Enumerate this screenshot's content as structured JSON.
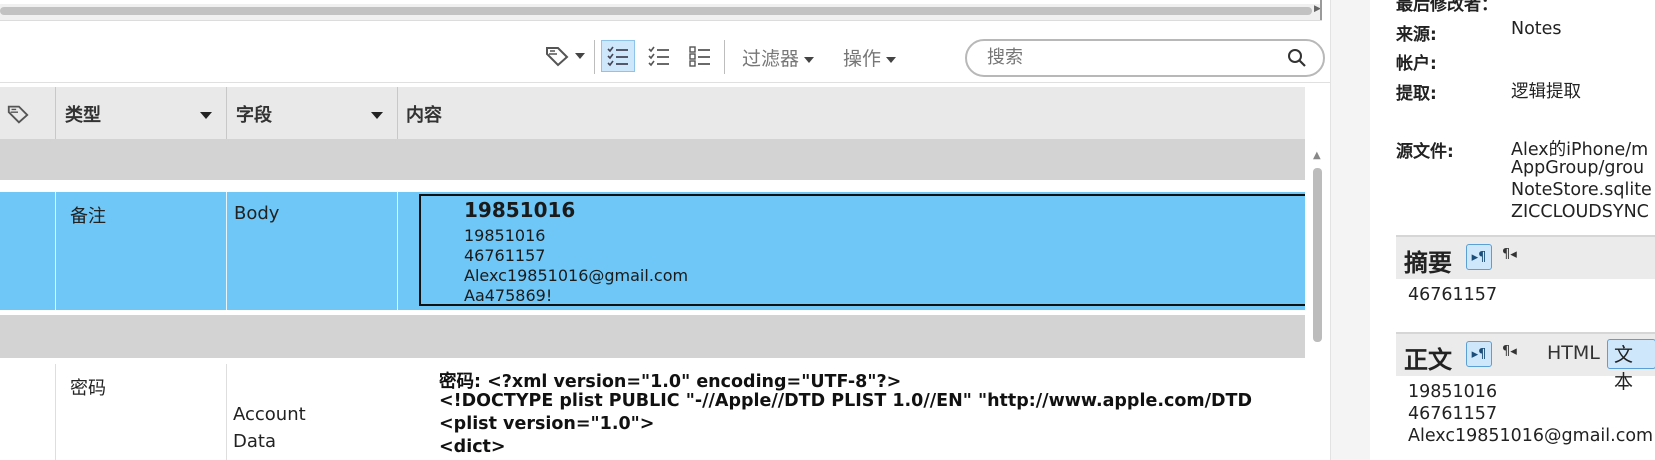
{
  "toolbar": {
    "filter_label": "过滤器",
    "actions_label": "操作",
    "search_placeholder": "搜索"
  },
  "table": {
    "columns": [
      "类型",
      "字段",
      "内容"
    ],
    "selected_row": {
      "type": "备注",
      "field": "Body",
      "content_title": "19851016",
      "content_lines": [
        "19851016",
        "46761157",
        "Alexc19851016@gmail.com",
        "Aa475869!"
      ]
    },
    "row2": {
      "type": "密码",
      "field_line1": "Account",
      "field_line2": "Data",
      "content_lines": [
        "密码: <?xml version=\"1.0\" encoding=\"UTF-8\"?>",
        "<!DOCTYPE plist PUBLIC \"-//Apple//DTD PLIST 1.0//EN\" \"http://www.apple.com/DTD",
        "<plist version=\"1.0\">",
        "<dict>"
      ]
    }
  },
  "details": {
    "last_modified_label": "最后修改者：",
    "source_label": "来源:",
    "source_value": "Notes",
    "account_label": "帐户:",
    "extraction_label": "提取:",
    "extraction_value": "逻辑提取",
    "source_file_label": "源文件:",
    "source_file_lines": [
      "Alex的iPhone/m",
      "AppGroup/grou",
      "NoteStore.sqlite",
      "ZICCLOUDSYNC"
    ],
    "summary": {
      "title": "摘要",
      "btn1": "▸¶",
      "btn2": "¶◂",
      "lines": [
        "46761157"
      ]
    },
    "body": {
      "title": "正文",
      "btn1": "▸¶",
      "btn2": "¶◂",
      "html_label": "HTML",
      "text_label": "文本",
      "lines": [
        "19851016",
        "46761157",
        "Alexc19851016@gmail.com"
      ]
    }
  },
  "colors": {
    "selected_row": "#6ec7f6",
    "group_row": "#d3d3d3",
    "header_bg": "#e9e9e9",
    "toggle_active": "#cfe7fb"
  }
}
